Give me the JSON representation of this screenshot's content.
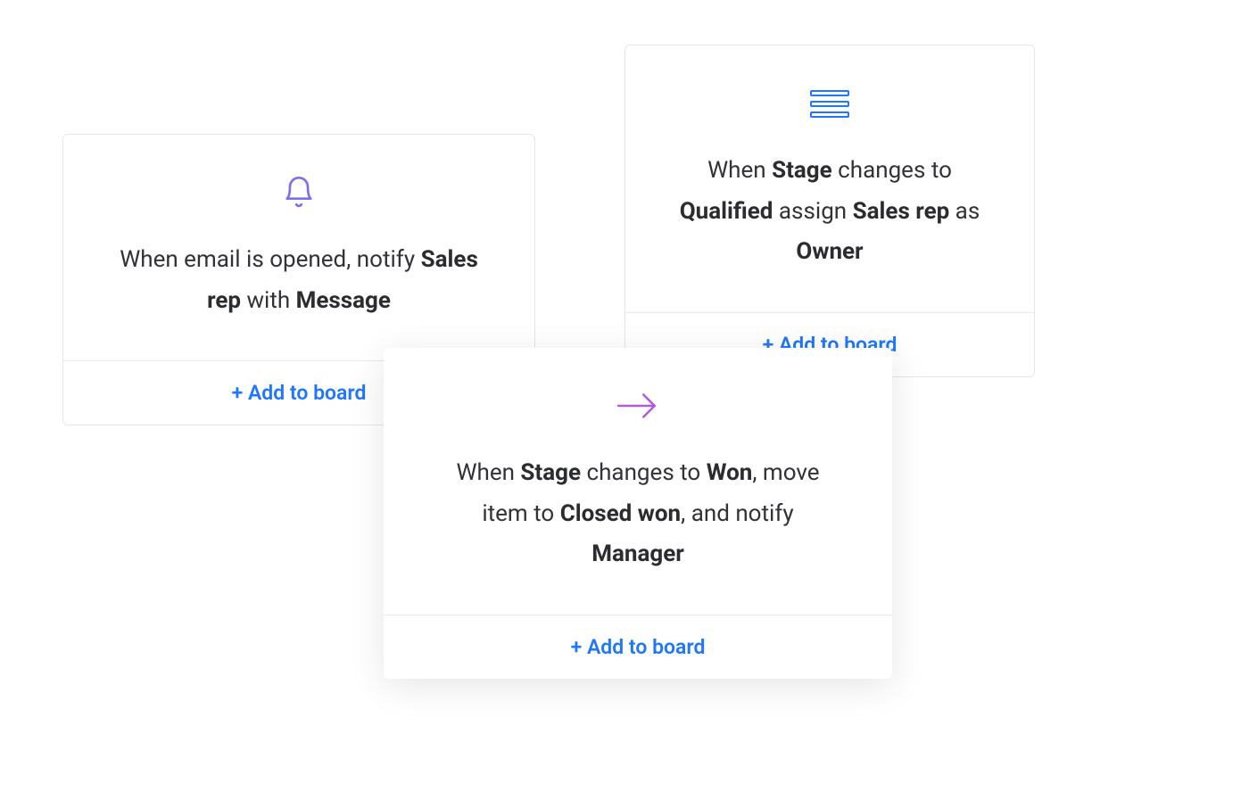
{
  "cards": [
    {
      "icon": "bell-icon",
      "segments": [
        {
          "text": "When email is opened, notify ",
          "bold": false
        },
        {
          "text": "Sales rep",
          "bold": true
        },
        {
          "text": " with ",
          "bold": false
        },
        {
          "text": "Message",
          "bold": true
        }
      ],
      "action_label": "+ Add to board"
    },
    {
      "icon": "list-icon",
      "segments": [
        {
          "text": "When ",
          "bold": false
        },
        {
          "text": "Stage",
          "bold": true
        },
        {
          "text": " changes to ",
          "bold": false
        },
        {
          "text": "Qualified",
          "bold": true
        },
        {
          "text": " assign ",
          "bold": false
        },
        {
          "text": "Sales rep",
          "bold": true
        },
        {
          "text": " as ",
          "bold": false
        },
        {
          "text": "Owner",
          "bold": true
        }
      ],
      "action_label": "+ Add to board"
    },
    {
      "icon": "arrow-right-icon",
      "segments": [
        {
          "text": "When ",
          "bold": false
        },
        {
          "text": "Stage",
          "bold": true
        },
        {
          "text": " changes to ",
          "bold": false
        },
        {
          "text": "Won",
          "bold": true
        },
        {
          "text": ", move item to ",
          "bold": false
        },
        {
          "text": "Closed won",
          "bold": true
        },
        {
          "text": ", and notify ",
          "bold": false
        },
        {
          "text": "Manager",
          "bold": true
        }
      ],
      "action_label": "+ Add to board"
    }
  ],
  "colors": {
    "link": "#1f76ff",
    "bell": "#7b6ff0",
    "arrow": "#b05adf",
    "text": "#323338",
    "border": "#e5e5ec"
  }
}
